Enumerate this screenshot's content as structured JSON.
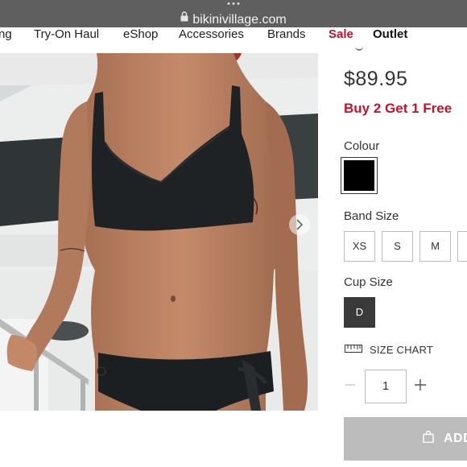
{
  "browser": {
    "url": "bikinivillage.com"
  },
  "nav": {
    "items": [
      {
        "id": "shopping",
        "label": "ng"
      },
      {
        "id": "try-on-haul",
        "label": "Try-On Haul"
      },
      {
        "id": "eshop",
        "label": "eShop"
      },
      {
        "id": "accessories",
        "label": "Accessories"
      },
      {
        "id": "brands",
        "label": "Brands"
      },
      {
        "id": "sale",
        "label": "Sale"
      },
      {
        "id": "outlet",
        "label": "Outlet"
      }
    ]
  },
  "product": {
    "price": "$89.95",
    "promo": "Buy 2 Get 1 Free",
    "colour_label": "Colour",
    "selected_colour": "#000000",
    "band_size_label": "Band Size",
    "band_sizes": [
      "XS",
      "S",
      "M",
      ""
    ],
    "cup_size_label": "Cup Size",
    "cup_sizes": [
      "D"
    ],
    "size_chart_label": "SIZE CHART",
    "quantity": "1",
    "add_to_cart_label": "ADD"
  },
  "colors": {
    "accent_red": "#c8102e",
    "selected_dark": "#3a3a3a",
    "add_button_disabled": "#bcbcbc"
  },
  "icons": {
    "lock": "lock-icon",
    "next": "chevron-right-icon",
    "ruler": "ruler-icon",
    "bag": "shopping-bag-icon",
    "minus": "minus-icon",
    "plus": "plus-icon"
  }
}
